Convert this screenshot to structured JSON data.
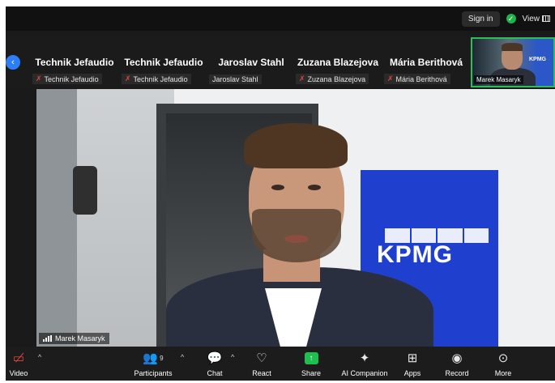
{
  "header": {
    "signin_label": "Sign in",
    "view_label": "View"
  },
  "strip": {
    "participants": [
      {
        "name": "Technik Jefaudio",
        "tag": "Technik Jefaudio",
        "muted": true
      },
      {
        "name": "Technik Jefaudio",
        "tag": "Technik Jefaudio",
        "muted": true
      },
      {
        "name": "Jaroslav Stahl",
        "tag": "Jaroslav Stahl",
        "muted": false
      },
      {
        "name": "Zuzana Blazejova",
        "tag": "Zuzana Blazejova",
        "muted": true
      },
      {
        "name": "Mária Berithová",
        "tag": "Mária Berithová",
        "muted": true
      }
    ],
    "self_tag": "Marek Masaryk",
    "self_logo": "KPMG"
  },
  "main_video": {
    "speaker_tag": "Marek Masaryk",
    "banner_text": "KPMG"
  },
  "toolbar": {
    "video_label": "Video",
    "participants_label": "Participants",
    "participants_count": "9",
    "chat_label": "Chat",
    "react_label": "React",
    "share_label": "Share",
    "ai_label": "AI Companion",
    "apps_label": "Apps",
    "record_label": "Record",
    "more_label": "More"
  },
  "colors": {
    "accent_green": "#21b24b",
    "accent_blue": "#2d7ff9",
    "muted_red": "#e0443b",
    "kpmg_blue": "#1f3fcf"
  }
}
